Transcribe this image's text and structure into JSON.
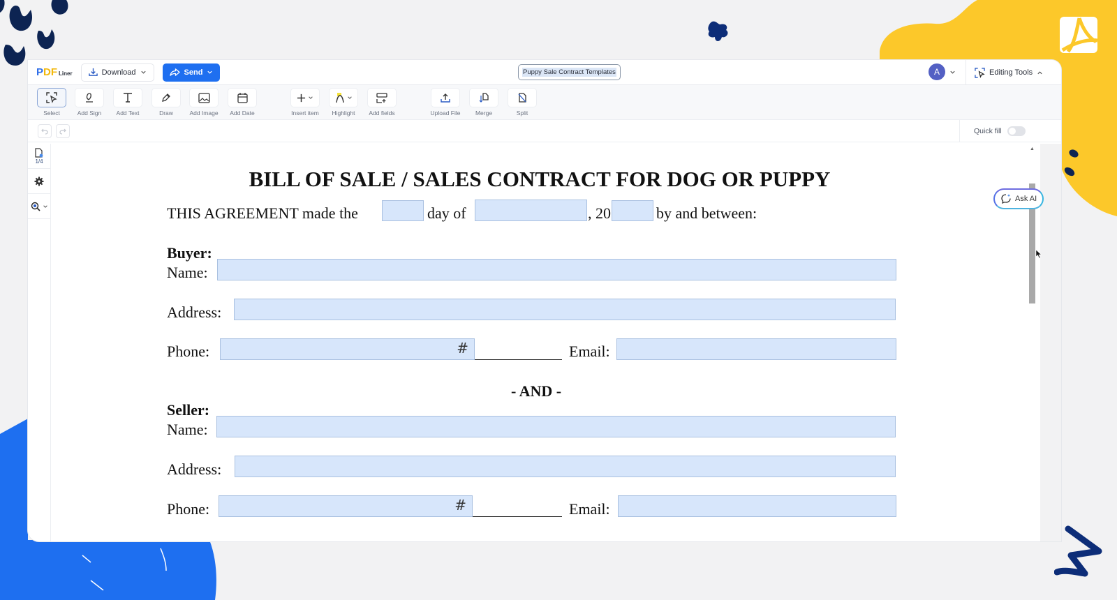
{
  "app": {
    "logo": {
      "p": "P",
      "d": "D",
      "f": "F",
      "liner": "Liner"
    },
    "download_label": "Download",
    "send_label": "Send",
    "template_chip": "Puppy Sale Contract Templates",
    "avatar_initial": "A",
    "editing_tools_label": "Editing Tools",
    "accent_color": "#1e6ff0"
  },
  "toolbar": {
    "tools": [
      {
        "label": "Select",
        "icon": "select-icon"
      },
      {
        "label": "Add Sign",
        "icon": "sign-icon"
      },
      {
        "label": "Add Text",
        "icon": "text-icon"
      },
      {
        "label": "Draw",
        "icon": "draw-icon"
      },
      {
        "label": "Add Image",
        "icon": "image-icon"
      },
      {
        "label": "Add Date",
        "icon": "calendar-icon"
      },
      {
        "label": "Insert item",
        "icon": "plus-icon"
      },
      {
        "label": "Highlight",
        "icon": "highlight-icon"
      },
      {
        "label": "Add fields",
        "icon": "fields-icon"
      },
      {
        "label": "Upload File",
        "icon": "upload-icon"
      },
      {
        "label": "Merge",
        "icon": "merge-icon"
      },
      {
        "label": "Split",
        "icon": "split-icon"
      }
    ]
  },
  "subbar": {
    "quick_fill_label": "Quick fill",
    "quick_fill_on": false
  },
  "rail": {
    "page_indicator": "1/4"
  },
  "ask_ai_label": "Ask AI",
  "document": {
    "title": "BILL OF SALE / SALES CONTRACT FOR DOG OR PUPPY",
    "agreement": {
      "part1": "THIS AGREEMENT made the",
      "part2": "day of",
      "part3": ", 20",
      "part4": "by and between:"
    },
    "buyer": {
      "heading": "Buyer:",
      "name_label": "Name:",
      "address_label": "Address:",
      "phone_label": "Phone:",
      "email_label": "Email:",
      "phone_hint": "#"
    },
    "and_label": "- AND -",
    "seller": {
      "heading": "Seller:",
      "name_label": "Name:",
      "address_label": "Address:",
      "phone_label": "Phone:",
      "email_label": "Email:",
      "phone_hint": "#"
    }
  }
}
